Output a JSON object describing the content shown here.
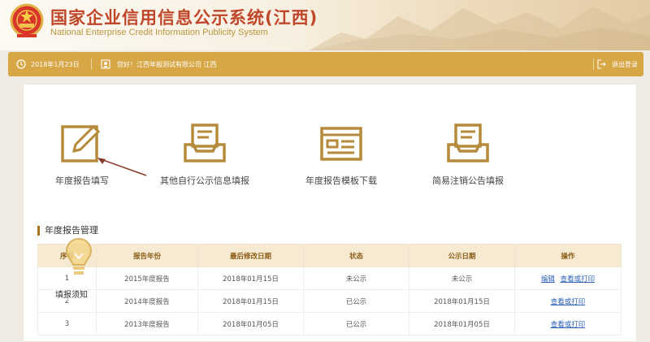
{
  "header": {
    "title": "国家企业信用信息公示系统(江西)",
    "subtitle": "National Enterprise Credit Information Publicity System"
  },
  "toolbar": {
    "date": "2018年1月23日",
    "greeting": "您好！江西年报测试有限公司 江西",
    "logout": "退出登录"
  },
  "functions": [
    {
      "label": "年度报告填写",
      "icon": "edit-icon"
    },
    {
      "label": "其他自行公示信息填报",
      "icon": "inbox-icon"
    },
    {
      "label": "年度报告模板下载",
      "icon": "template-icon"
    },
    {
      "label": "简易注销公告填报",
      "icon": "inbox-icon"
    }
  ],
  "section": {
    "title": "年度报告管理"
  },
  "table": {
    "headers": [
      "序号",
      "报告年份",
      "最后修改日期",
      "状态",
      "公示日期",
      "操作"
    ],
    "rows": [
      {
        "no": "1",
        "year": "2015年度报告",
        "modified": "2018年01月15日",
        "status": "未公示",
        "published": "未公示",
        "actions": [
          "编辑",
          "查看或打印"
        ]
      },
      {
        "no": "2",
        "year": "2014年度报告",
        "modified": "2018年01月15日",
        "status": "已公示",
        "published": "2018年01月15日",
        "actions": [
          "查看或打印"
        ]
      },
      {
        "no": "3",
        "year": "2013年度报告",
        "modified": "2018年01月05日",
        "status": "已公示",
        "published": "2018年01月05日",
        "actions": [
          "查看或打印"
        ]
      }
    ]
  },
  "tip": {
    "label": "填报须知"
  },
  "colors": {
    "accent": "#d7a645",
    "title": "#c0462a",
    "icon": "#b58a3a",
    "link": "#2a5fb3"
  }
}
